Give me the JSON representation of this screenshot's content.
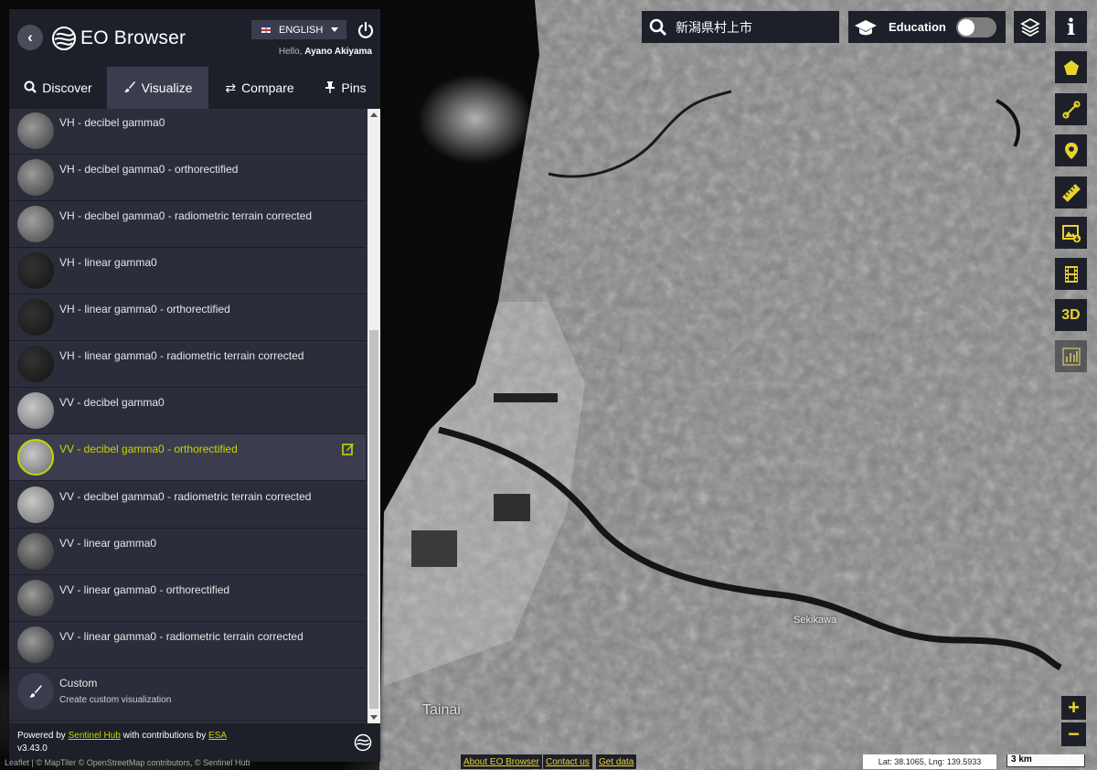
{
  "app": {
    "title": "EO Browser",
    "language": "ENGLISH",
    "greeting_prefix": "Hello,",
    "user_name": "Ayano Akiyama"
  },
  "tabs": [
    {
      "label": "Discover",
      "icon": "search-icon"
    },
    {
      "label": "Visualize",
      "icon": "brush-icon",
      "active": true
    },
    {
      "label": "Compare",
      "icon": "compare-arrows-icon"
    },
    {
      "label": "Pins",
      "icon": "pin-icon"
    }
  ],
  "visualizations": [
    {
      "label": "VH - decibel gamma0"
    },
    {
      "label": "VH - decibel gamma0 - orthorectified"
    },
    {
      "label": "VH - decibel gamma0 - radiometric terrain corrected"
    },
    {
      "label": "VH - linear gamma0"
    },
    {
      "label": "VH - linear gamma0 - orthorectified"
    },
    {
      "label": "VH - linear gamma0 - radiometric terrain corrected"
    },
    {
      "label": "VV - decibel gamma0"
    },
    {
      "label": "VV - decibel gamma0 - orthorectified",
      "selected": true
    },
    {
      "label": "VV - decibel gamma0 - radiometric terrain corrected"
    },
    {
      "label": "VV - linear gamma0"
    },
    {
      "label": "VV - linear gamma0 - orthorectified"
    },
    {
      "label": "VV - linear gamma0 - radiometric terrain corrected"
    }
  ],
  "custom": {
    "label": "Custom",
    "sublabel": "Create custom visualization"
  },
  "footer": {
    "powered_prefix": "Powered by",
    "sentinel_hub": "Sentinel Hub",
    "contrib_text": "with contributions by",
    "esa": "ESA",
    "version": "v3.43.0"
  },
  "search": {
    "value": "新潟県村上市"
  },
  "education": {
    "label": "Education",
    "enabled": false
  },
  "map": {
    "labels": {
      "tainai": "Tainai",
      "sekikawa": "Sekikawa"
    },
    "attribution": "Leaflet | © MapTiler © OpenStreetMap contributors, © Sentinel Hub",
    "coords": "Lat: 38.1065, Lng: 139.5933",
    "scale": "3 km"
  },
  "bottom_links": {
    "about": "About EO Browser",
    "contact": "Contact us",
    "data": "Get data"
  },
  "toolbar": {
    "three_d": "3D",
    "zoom_in": "+",
    "zoom_out": "−"
  },
  "colors": {
    "accent": "#c4d600",
    "tool_yellow": "#e8d32e",
    "panel_dark": "#1e2029",
    "panel": "#3b3d4f"
  }
}
